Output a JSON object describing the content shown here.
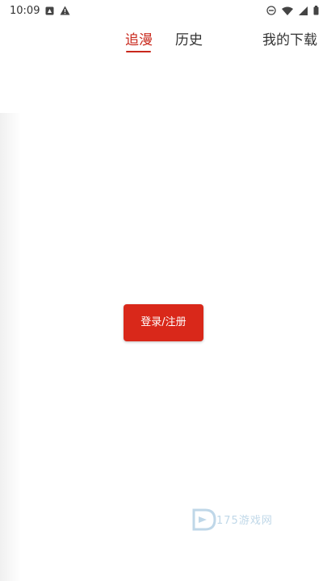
{
  "status_bar": {
    "time": "10:09",
    "icons": [
      "notification-icon",
      "warning-icon",
      "do-not-disturb-icon",
      "wifi-icon",
      "signal-icon",
      "battery-icon"
    ]
  },
  "top_nav": {
    "tabs": [
      {
        "label": "追漫",
        "active": true
      },
      {
        "label": "历史",
        "active": false
      }
    ],
    "download_label": "我的下载",
    "accent_color": "#c9281c"
  },
  "main": {
    "login_button_label": "登录/注册",
    "button_color": "#d9281a"
  },
  "watermark": {
    "text": "175游戏网"
  }
}
